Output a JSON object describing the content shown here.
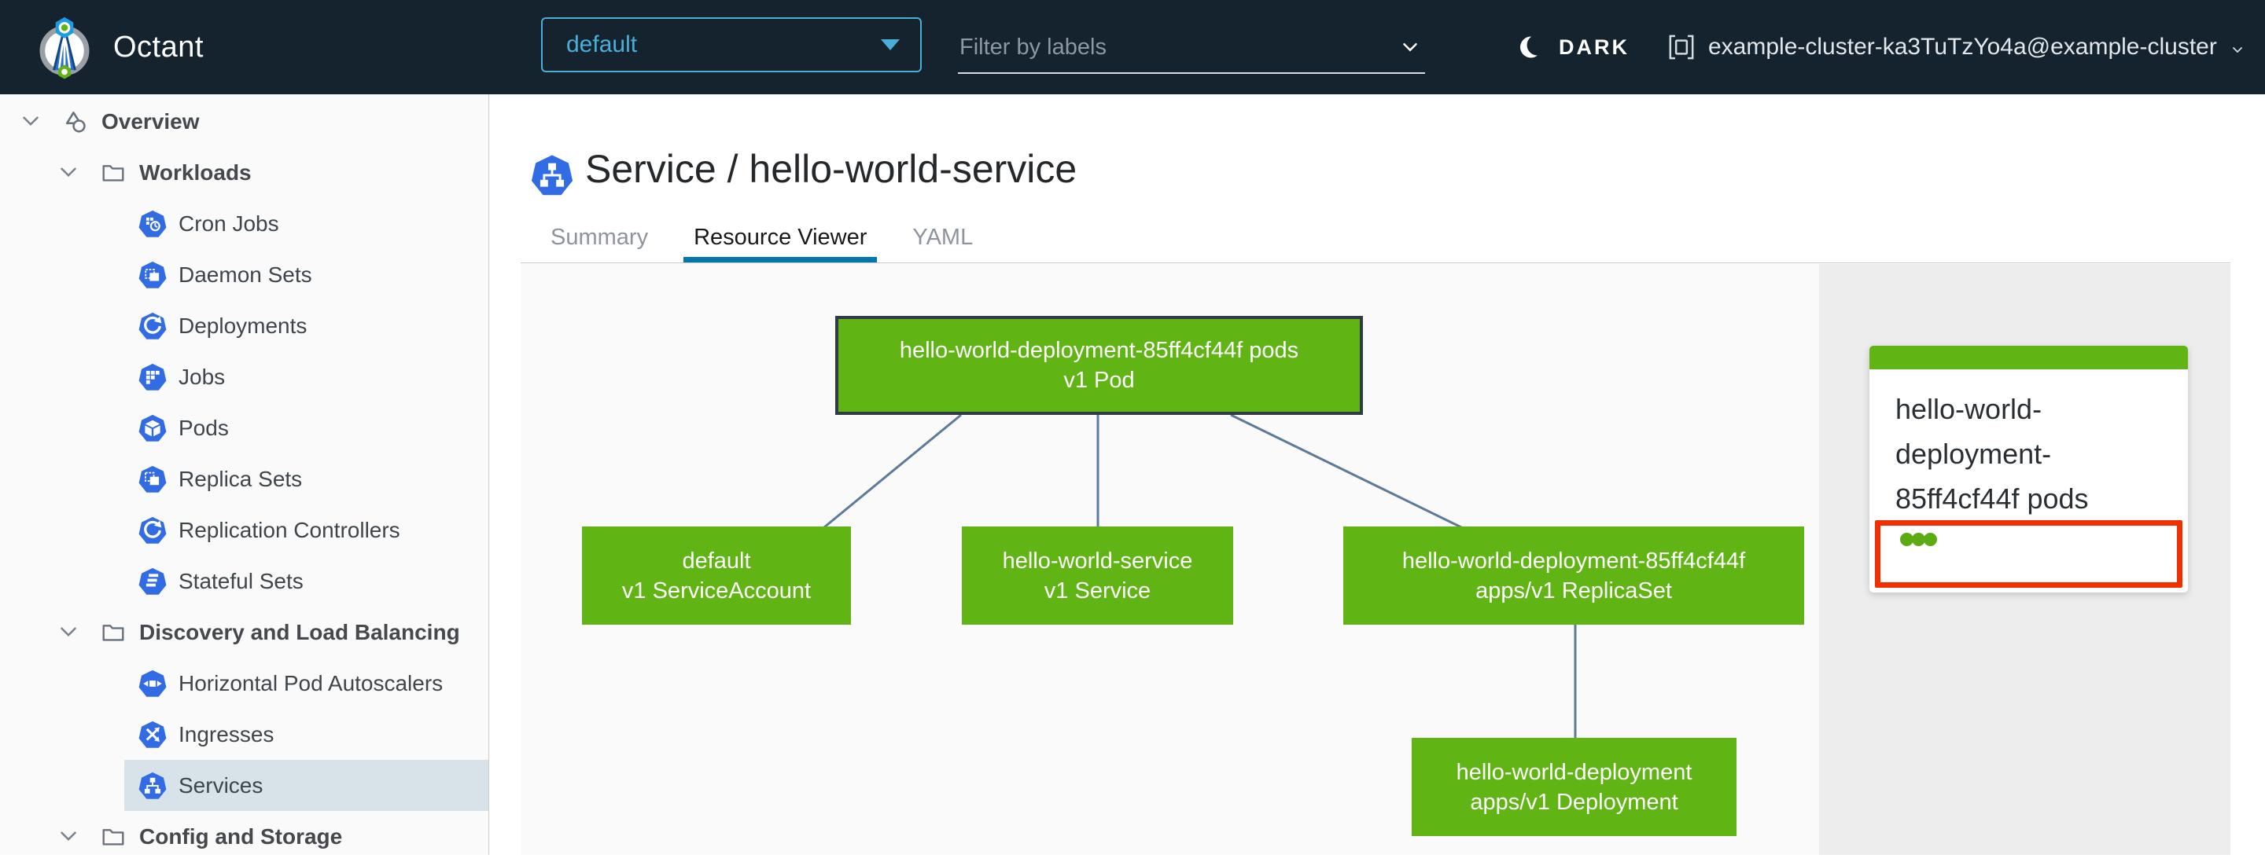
{
  "header": {
    "app_title": "Octant",
    "namespace_selector": {
      "value": "default"
    },
    "filter": {
      "placeholder": "Filter by labels"
    },
    "theme_toggle": {
      "label": "DARK"
    },
    "cluster": {
      "label": "example-cluster-ka3TuTzYo4a@example-cluster"
    }
  },
  "sidebar": {
    "items": [
      {
        "label": "Overview",
        "level": 0,
        "icon": "objects",
        "expandable": true,
        "group": true
      },
      {
        "label": "Workloads",
        "level": 1,
        "icon": "folder",
        "expandable": true,
        "group": true
      },
      {
        "label": "Cron Jobs",
        "level": 2,
        "icon": "cronjob"
      },
      {
        "label": "Daemon Sets",
        "level": 2,
        "icon": "daemonset"
      },
      {
        "label": "Deployments",
        "level": 2,
        "icon": "deployment"
      },
      {
        "label": "Jobs",
        "level": 2,
        "icon": "job"
      },
      {
        "label": "Pods",
        "level": 2,
        "icon": "pod"
      },
      {
        "label": "Replica Sets",
        "level": 2,
        "icon": "replicaset"
      },
      {
        "label": "Replication Controllers",
        "level": 2,
        "icon": "replicationcontroller"
      },
      {
        "label": "Stateful Sets",
        "level": 2,
        "icon": "statefulset"
      },
      {
        "label": "Discovery and Load Balancing",
        "level": 1,
        "icon": "folder",
        "expandable": true,
        "group": true
      },
      {
        "label": "Horizontal Pod Autoscalers",
        "level": 2,
        "icon": "hpa"
      },
      {
        "label": "Ingresses",
        "level": 2,
        "icon": "ingress"
      },
      {
        "label": "Services",
        "level": 2,
        "icon": "service",
        "selected": true
      },
      {
        "label": "Config and Storage",
        "level": 1,
        "icon": "folder",
        "expandable": true,
        "group": true
      }
    ]
  },
  "main": {
    "title": "Service / hello-world-service",
    "title_icon": "service",
    "tabs": [
      {
        "label": "Summary",
        "active": false
      },
      {
        "label": "Resource Viewer",
        "active": true
      },
      {
        "label": "YAML",
        "active": false
      }
    ]
  },
  "resource_graph": {
    "nodes": [
      {
        "id": "pod",
        "title": "hello-world-deployment-85ff4cf44f pods",
        "subtitle": "v1 Pod",
        "status": "ok",
        "selected": true
      },
      {
        "id": "serviceaccount",
        "title": "default",
        "subtitle": "v1 ServiceAccount",
        "status": "ok",
        "selected": false
      },
      {
        "id": "service",
        "title": "hello-world-service",
        "subtitle": "v1 Service",
        "status": "ok",
        "selected": false
      },
      {
        "id": "replicaset",
        "title": "hello-world-deployment-85ff4cf44f",
        "subtitle": "apps/v1 ReplicaSet",
        "status": "ok",
        "selected": false
      },
      {
        "id": "deployment",
        "title": "hello-world-deployment",
        "subtitle": "apps/v1 Deployment",
        "status": "ok",
        "selected": false
      }
    ],
    "edges": [
      [
        "pod",
        "serviceaccount"
      ],
      [
        "pod",
        "service"
      ],
      [
        "pod",
        "replicaset"
      ],
      [
        "replicaset",
        "deployment"
      ]
    ]
  },
  "detail_panel": {
    "title": "hello-world-deployment-85ff4cf44f pods",
    "pod_status_ok_count": 3
  },
  "colors": {
    "header_bg": "#15232e",
    "accent_blue": "#49afd9",
    "k8s_icon_blue": "#326ce5",
    "node_green": "#60b515",
    "edge_blue": "#5c7a99",
    "selected_row_bg": "#d8e3e9",
    "active_tab_underline": "#0077ad",
    "alert_red": "#f13000",
    "panel_bg": "#ededed",
    "sidebar_bg": "#fafafa"
  }
}
